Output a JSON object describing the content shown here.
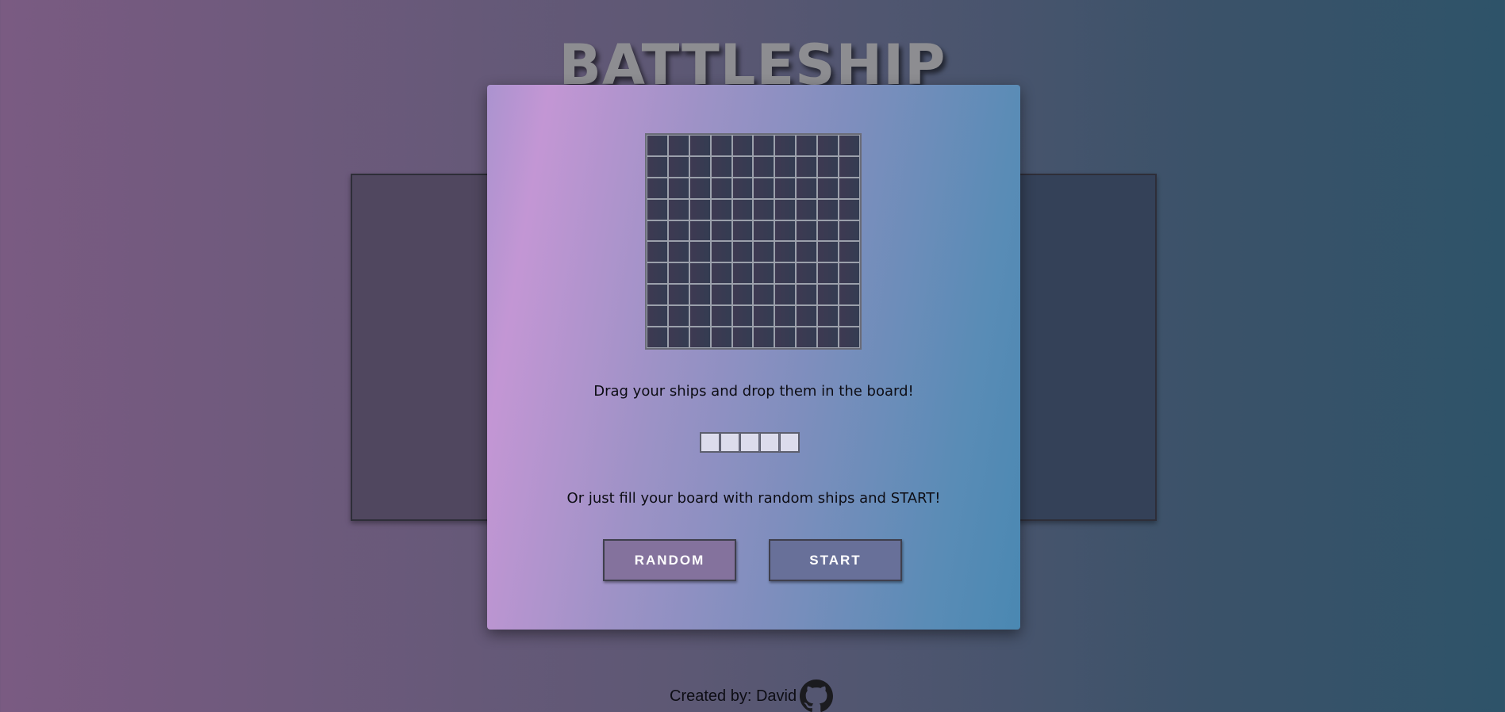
{
  "app": {
    "title": "BATTLESHIP"
  },
  "setup": {
    "drag_instruction": "Drag your ships and drop them in the board!",
    "random_instruction": "Or just fill your board with random ships and START!",
    "ship_segments": 5,
    "board_size": 10
  },
  "buttons": {
    "random_label": "RANDOM",
    "start_label": "START"
  },
  "footer": {
    "credit": "Created by: David",
    "icon": "github-icon"
  },
  "colors": {
    "random_button": "#84729d",
    "start_button": "#687099",
    "board_cell": "#383d52",
    "ship_segment": "#dcdcec"
  }
}
